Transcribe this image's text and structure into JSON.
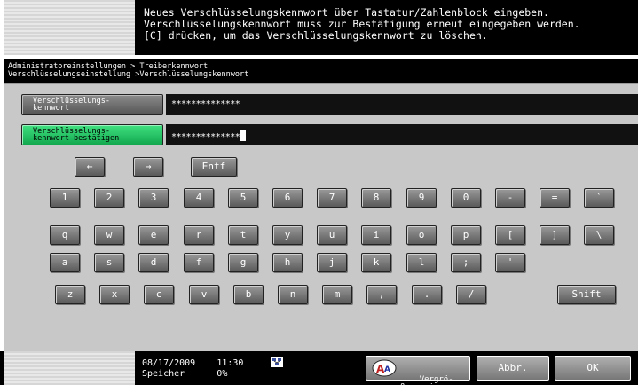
{
  "message": {
    "line1": "Neues Verschlüsselungskennwort über Tastatur/Zahlenblock eingeben.",
    "line2": "Verschlüsselungskennwort muss zur Bestätigung erneut eingegeben werden.",
    "line3": "[C] drücken, um das Verschlüsselungskennwort zu löschen."
  },
  "breadcrumb": {
    "line1": "Administratoreinstellungen > Treiberkennwort",
    "line2": "Verschlüsselungseinstellung >Verschlüsselungskennwort"
  },
  "fields": {
    "password": {
      "label": "Verschlüsselungs-\nkennwort",
      "value": "**************"
    },
    "confirm": {
      "label": "Verschlüsselungs-\nkennwort bestätigen",
      "value": "**************"
    }
  },
  "keyboard": {
    "nav": [
      "←",
      "→",
      "Entf"
    ],
    "row1": [
      "1",
      "2",
      "3",
      "4",
      "5",
      "6",
      "7",
      "8",
      "9",
      "0",
      "-",
      "=",
      "`"
    ],
    "row2": [
      "q",
      "w",
      "e",
      "r",
      "t",
      "y",
      "u",
      "i",
      "o",
      "p",
      "[",
      "]",
      "\\"
    ],
    "row3": [
      "a",
      "s",
      "d",
      "f",
      "g",
      "h",
      "j",
      "k",
      "l",
      ";",
      "'"
    ],
    "row4": [
      "z",
      "x",
      "c",
      "v",
      "b",
      "n",
      "m",
      ",",
      ".",
      "/"
    ],
    "shift": "Shift"
  },
  "status": {
    "date": "08/17/2009",
    "time": "11:30",
    "memory_label": "Speicher",
    "memory_value": "0%"
  },
  "buttons": {
    "enlarge": "Vergrö-\nßern ein",
    "cancel": "Abbr.",
    "ok": "OK"
  },
  "colors": {
    "active_field": "#12a84e",
    "key_gray": "#7a7a7a"
  },
  "icons": {
    "network": "network-icon",
    "enlarge": "magnify-text-icon"
  }
}
